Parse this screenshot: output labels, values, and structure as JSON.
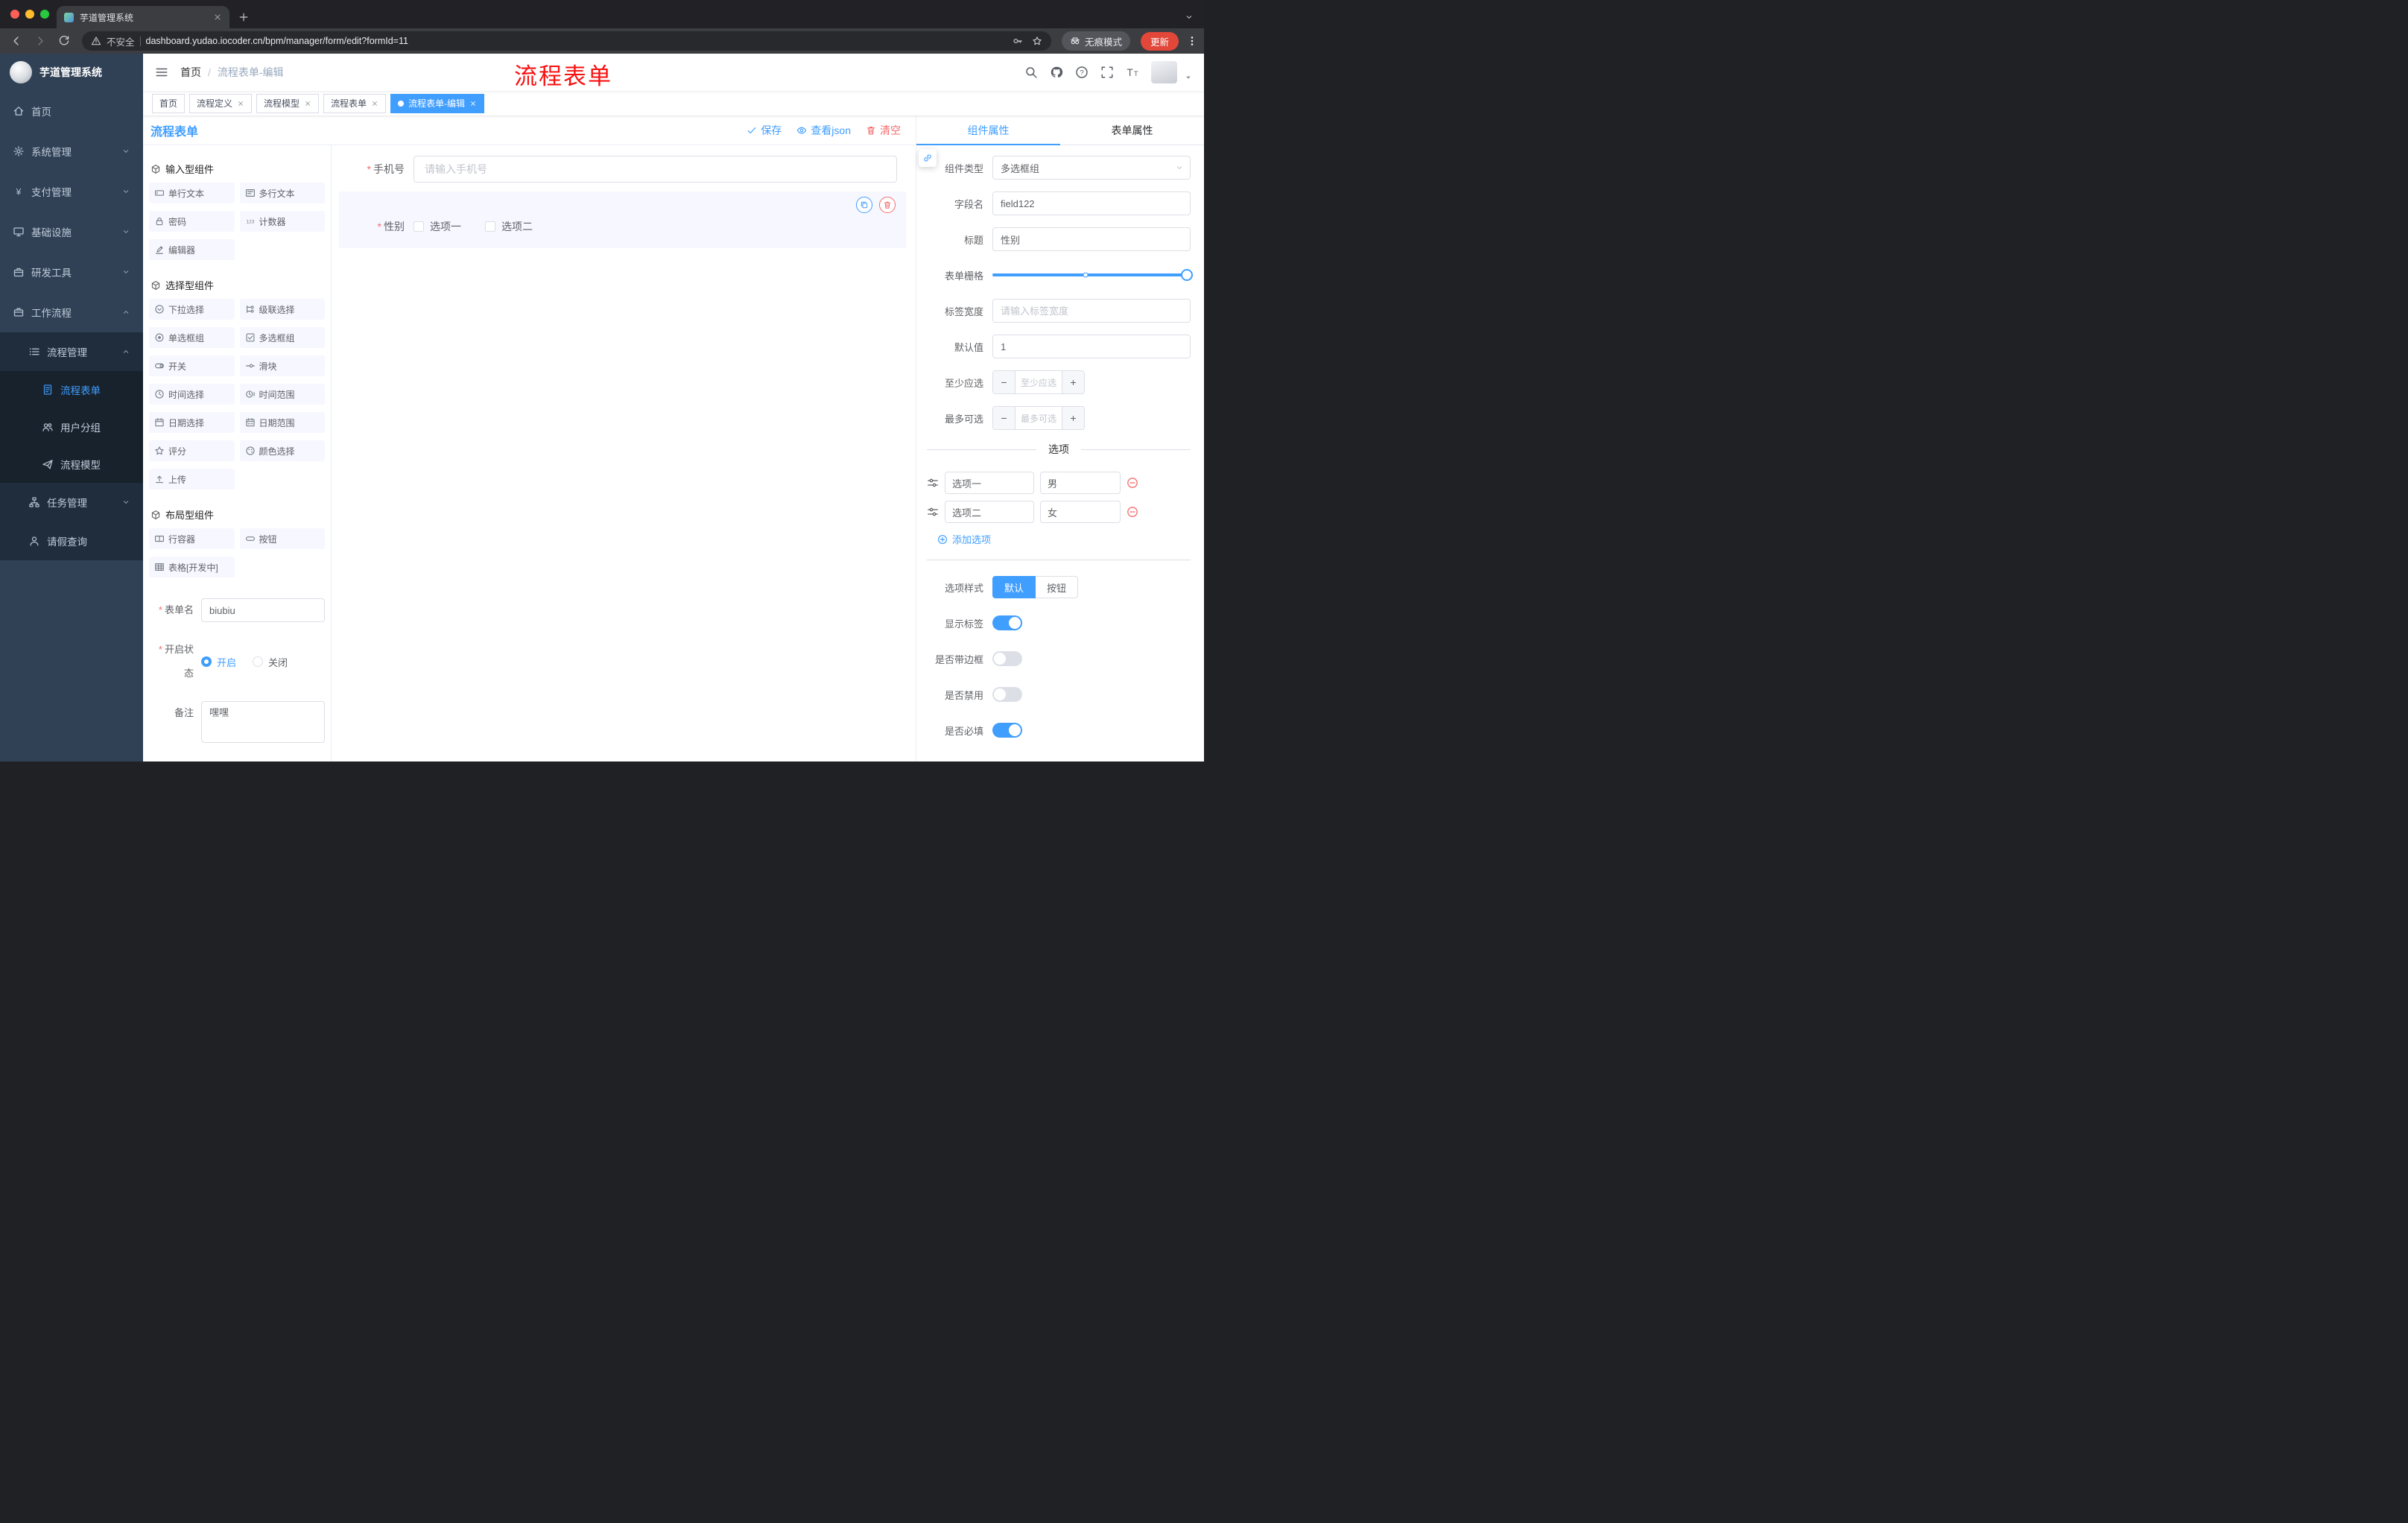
{
  "colors": {
    "accent": "#409eff",
    "danger": "#f56c6c",
    "sidebar": "#304156",
    "tag_active": "#409eff",
    "annotation_red": "#f80f0f",
    "update_pill": "#e2473a"
  },
  "icons": {
    "save": "check",
    "view_json": "eye",
    "clear": "trash",
    "copy_component": "copy",
    "delete_component": "trash",
    "add_option": "plus-circle",
    "remove_option": "minus-circle",
    "option_drag": "sliders",
    "doc_link": "link",
    "header_right": [
      "search",
      "github",
      "question-circle",
      "fullscreen",
      "font-size",
      "avatar"
    ]
  },
  "browser": {
    "tab_title": "芋道管理系统",
    "address": {
      "security": "不安全",
      "url": "dashboard.yudao.iocoder.cn/bpm/manager/form/edit?formId=11"
    },
    "incognito_badge": "无痕模式",
    "update_button": "更新"
  },
  "app": {
    "logo_title": "芋道管理系统",
    "breadcrumb": {
      "root": "首页",
      "separator": "/",
      "current": "流程表单-编辑"
    },
    "annotation": "流程表单",
    "menu": [
      {
        "label": "首页"
      },
      {
        "label": "系统管理"
      },
      {
        "label": "支付管理"
      },
      {
        "label": "基础设施"
      },
      {
        "label": "研发工具"
      },
      {
        "label": "工作流程"
      },
      {
        "label": "流程管理"
      },
      {
        "label": "流程表单"
      },
      {
        "label": "用户分组"
      },
      {
        "label": "流程模型"
      },
      {
        "label": "任务管理"
      },
      {
        "label": "请假查询"
      }
    ],
    "tags": [
      {
        "label": "首页"
      },
      {
        "label": "流程定义"
      },
      {
        "label": "流程模型"
      },
      {
        "label": "流程表单"
      },
      {
        "label": "流程表单-编辑"
      }
    ]
  },
  "designer": {
    "panel_title": "流程表单",
    "actions": {
      "save": "保存",
      "view_json": "查看json",
      "clear": "清空"
    },
    "palette": {
      "sections": [
        {
          "title": "输入型组件",
          "items": [
            "单行文本",
            "多行文本",
            "密码",
            "计数器",
            "编辑器"
          ]
        },
        {
          "title": "选择型组件",
          "items": [
            "下拉选择",
            "级联选择",
            "单选框组",
            "多选框组",
            "开关",
            "滑块",
            "时间选择",
            "时间范围",
            "日期选择",
            "日期范围",
            "评分",
            "颜色选择",
            "上传"
          ]
        },
        {
          "title": "布局型组件",
          "items": [
            "行容器",
            "按钮",
            "表格[开发中]"
          ]
        }
      ]
    },
    "meta": {
      "form_name": {
        "label": "表单名",
        "value": "biubiu"
      },
      "status": {
        "label": "开启状态",
        "on": "开启",
        "off": "关闭"
      },
      "remark": {
        "label": "备注",
        "value": "嘿嘿"
      }
    },
    "canvas": {
      "phone": {
        "label": "手机号",
        "placeholder": "请输入手机号"
      },
      "gender": {
        "label": "性别",
        "options": [
          "选项一",
          "选项二"
        ]
      }
    }
  },
  "props": {
    "tabs": {
      "component": "组件属性",
      "form": "表单属性"
    },
    "rows": {
      "type": {
        "label": "组件类型",
        "value": "多选框组"
      },
      "field": {
        "label": "字段名",
        "value": "field122"
      },
      "title": {
        "label": "标题",
        "value": "性别"
      },
      "grid": {
        "label": "表单栅格"
      },
      "label_width": {
        "label": "标签宽度",
        "placeholder": "请输入标签宽度"
      },
      "default": {
        "label": "默认值",
        "value": "1"
      },
      "min": {
        "label": "至少应选",
        "placeholder": "至少应选"
      },
      "max": {
        "label": "最多可选",
        "placeholder": "最多可选"
      }
    },
    "options": {
      "divider": "选项",
      "items": [
        {
          "name": "选项一",
          "value": "男"
        },
        {
          "name": "选项二",
          "value": "女"
        }
      ],
      "add": "添加选项"
    },
    "option_style": {
      "label": "选项样式",
      "choices": [
        "默认",
        "按钮"
      ]
    },
    "switches": [
      {
        "label": "显示标签",
        "on": true
      },
      {
        "label": "是否带边框",
        "on": false
      },
      {
        "label": "是否禁用",
        "on": false
      },
      {
        "label": "是否必填",
        "on": true
      }
    ]
  }
}
